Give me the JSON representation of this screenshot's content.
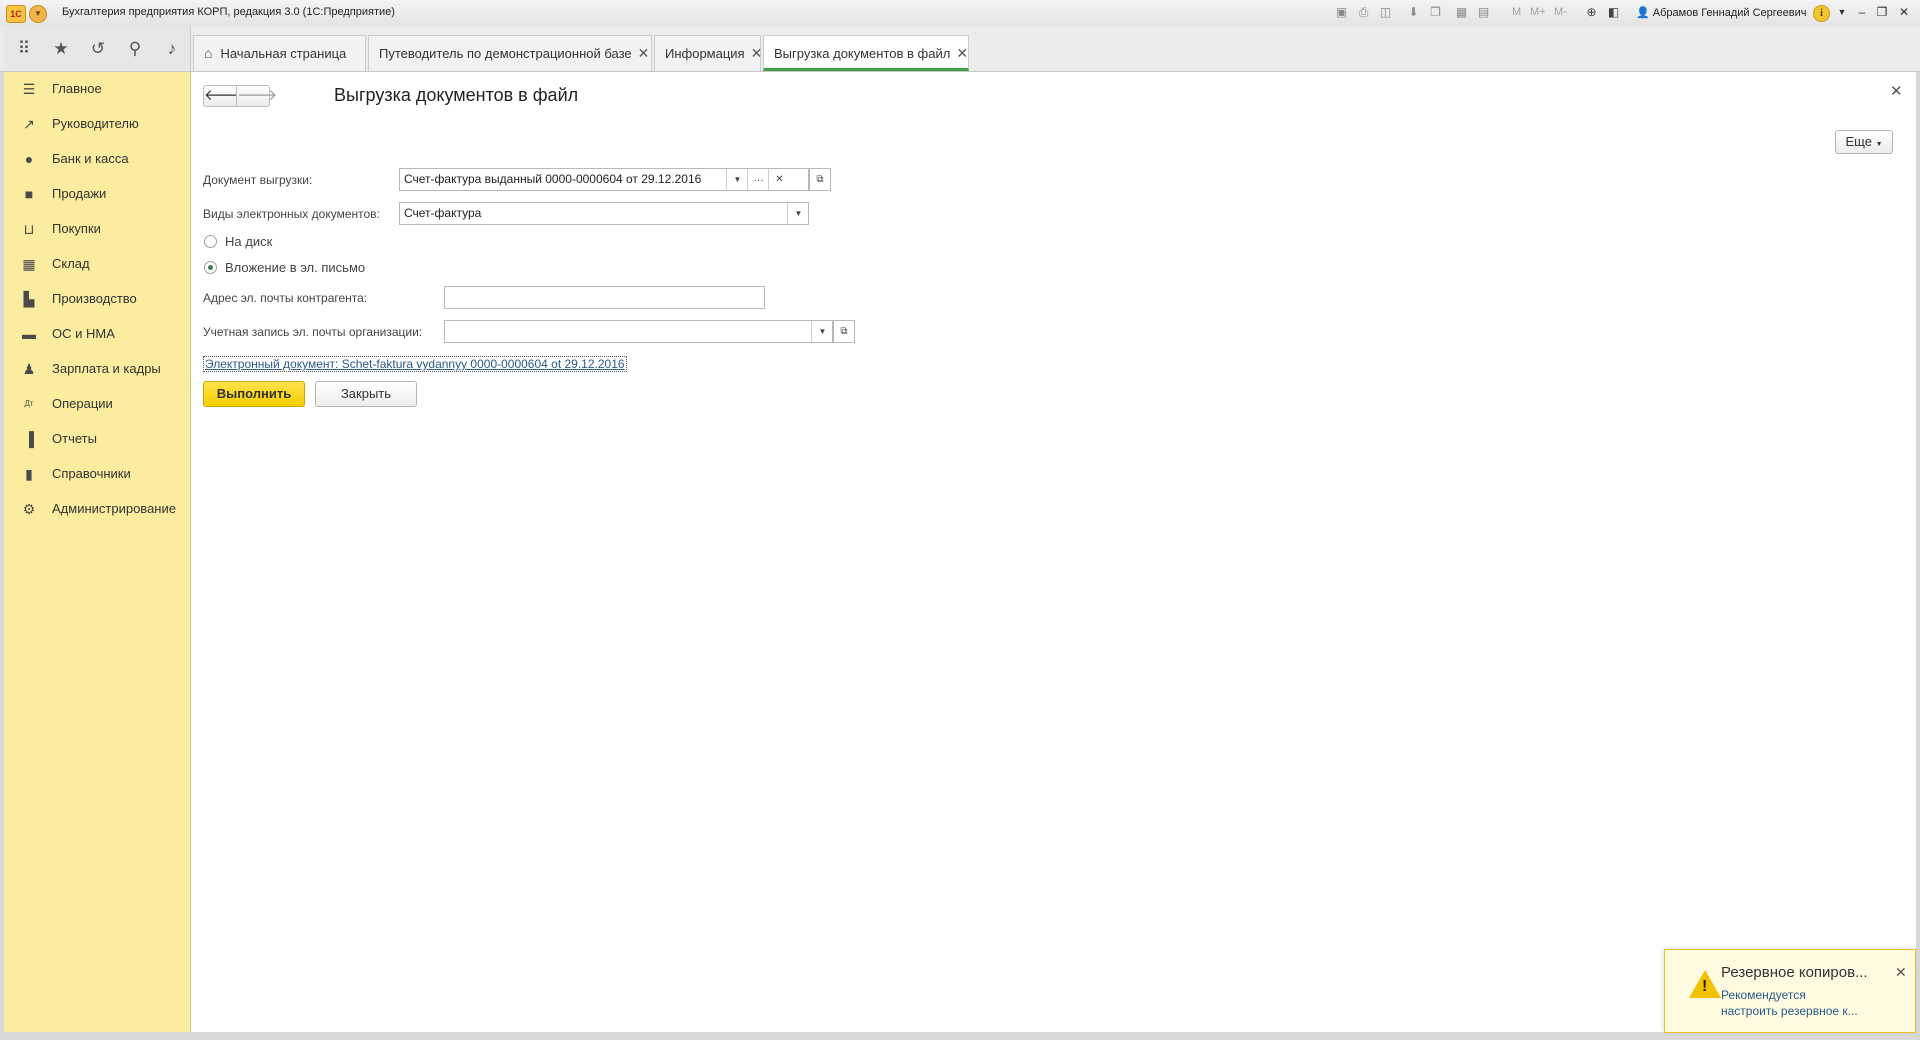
{
  "window": {
    "title": "Бухгалтерия предприятия КОРП, редакция 3.0  (1С:Предприятие)",
    "user": "Абрамов Геннадий Сергеевич",
    "m_buttons": [
      "M",
      "M+",
      "M-"
    ]
  },
  "tabs": [
    {
      "label": "Начальная страница",
      "closable": false
    },
    {
      "label": "Путеводитель по демонстрационной базе",
      "closable": true
    },
    {
      "label": "Информация",
      "closable": true
    },
    {
      "label": "Выгрузка документов в файл",
      "closable": true,
      "active": true
    }
  ],
  "sidebar": {
    "items": [
      {
        "label": "Главное",
        "icon": "menu-lines-icon"
      },
      {
        "label": "Руководителю",
        "icon": "trend-icon"
      },
      {
        "label": "Банк и касса",
        "icon": "ruble-coin-icon"
      },
      {
        "label": "Продажи",
        "icon": "shopping-bag-icon"
      },
      {
        "label": "Покупки",
        "icon": "cart-icon"
      },
      {
        "label": "Склад",
        "icon": "warehouse-grid-icon"
      },
      {
        "label": "Производство",
        "icon": "factory-icon"
      },
      {
        "label": "ОС и НМА",
        "icon": "truck-icon"
      },
      {
        "label": "Зарплата и кадры",
        "icon": "person-icon"
      },
      {
        "label": "Операции",
        "icon": "dt-kt-icon"
      },
      {
        "label": "Отчеты",
        "icon": "bar-chart-icon"
      },
      {
        "label": "Справочники",
        "icon": "books-icon"
      },
      {
        "label": "Администрирование",
        "icon": "gear-icon"
      }
    ]
  },
  "form": {
    "title": "Выгрузка документов в файл",
    "more_label": "Еще",
    "doc_label": "Документ выгрузки:",
    "doc_value": "Счет-фактура выданный 0000-0000604 от 29.12.2016",
    "types_label": "Виды электронных документов:",
    "types_value": "Счет-фактура",
    "radio_disk": "На диск",
    "radio_email": "Вложение в эл. письмо",
    "radio_selected": "email",
    "email_label": "Адрес эл. почты контрагента:",
    "email_value": "",
    "account_label": "Учетная запись эл. почты организации:",
    "account_value": "",
    "edoc_link": "Электронный документ: Schet-faktura vydannyy 0000-0000604 ot 29.12.2016",
    "run_label": "Выполнить",
    "close_label": "Закрыть"
  },
  "notification": {
    "title": "Резервное копиров...",
    "line1": "Рекомендуется",
    "line2": "настроить резервное к..."
  }
}
